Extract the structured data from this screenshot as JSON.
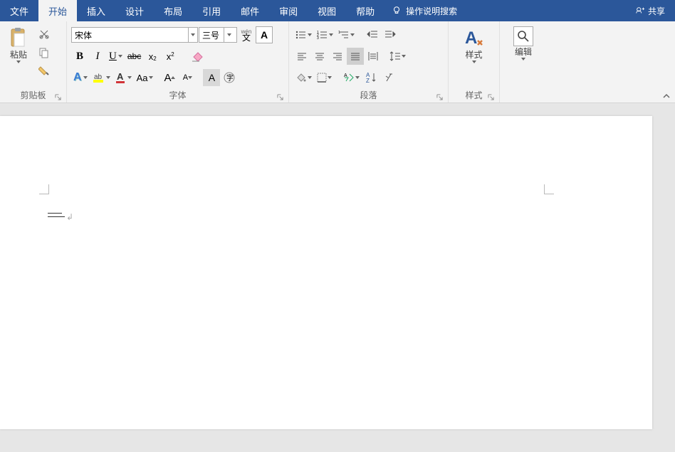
{
  "tabs": {
    "file": "文件",
    "home": "开始",
    "insert": "插入",
    "design": "设计",
    "layout": "布局",
    "references": "引用",
    "mailings": "邮件",
    "review": "审阅",
    "view": "视图",
    "help": "帮助"
  },
  "search_placeholder": "操作说明搜索",
  "share_label": "共享",
  "groups": {
    "clipboard": "剪贴板",
    "font": "字体",
    "paragraph": "段落",
    "styles": "样式",
    "editing": "编辑"
  },
  "clipboard": {
    "paste": "粘贴"
  },
  "font": {
    "name": "宋体",
    "size": "三号",
    "phonetic": "wén",
    "bold": "B",
    "italic": "I",
    "underline": "U",
    "strike": "abc",
    "sub": "x",
    "sup": "x",
    "effects": "A",
    "highlight": "ab",
    "color": "A",
    "case": "Aa",
    "grow": "A",
    "shrink": "A",
    "clear": "A"
  },
  "styles": {
    "label": "样式"
  },
  "editing": {
    "label": "编辑"
  }
}
